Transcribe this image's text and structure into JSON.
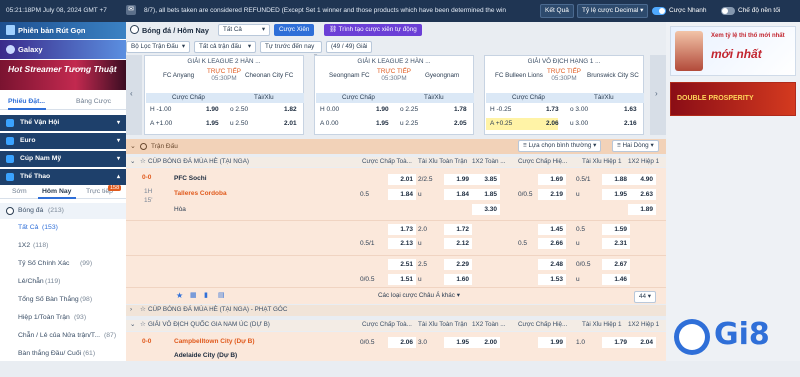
{
  "topbar": {
    "time": "05:21:18PM July 08, 2024 GMT +7",
    "ticker": "8/7), all bets taken are considered REFUNDED (Except Set 1 winner and those products which have been determined the win",
    "result_btn": "Kết Quả",
    "odds_type": "Tỷ lệ cược Decimal",
    "quick_bet": "Cược Nhanh",
    "night_mode": "Chế độ nền tối"
  },
  "sidebar": {
    "banners": [
      "Phiên bản Rút Gọn",
      "Galaxy",
      "Hot Streamer Tương Thuật"
    ],
    "tabs": [
      "Phiếu Đặt...",
      "Bảng Cược"
    ],
    "menu": [
      "Thể Vận Hội",
      "Euro",
      "Cúp Nam Mỹ",
      "Thể Thao"
    ],
    "sport_tabs": [
      "Sớm",
      "Hôm Nay",
      "Trực tiếp"
    ],
    "live_count": "158",
    "sport_header": {
      "name": "Bóng đá",
      "count": "(213)"
    },
    "items": [
      {
        "name": "Tất Cả",
        "count": "(153)"
      },
      {
        "name": "1X2",
        "count": "(118)"
      },
      {
        "name": "Tỷ Số Chính Xác",
        "count": "(99)"
      },
      {
        "name": "Lẻ/Chẵn",
        "count": "(119)"
      },
      {
        "name": "Tổng Số Bàn Thắng",
        "count": "(98)"
      },
      {
        "name": "Hiệp 1/Toàn Trận",
        "count": "(93)"
      },
      {
        "name": "Chẵn / Lẻ của Nửa trận/T...",
        "count": "(87)"
      },
      {
        "name": "Bàn thắng Đầu/ Cuối",
        "count": "(61)"
      }
    ]
  },
  "toolbar": {
    "title": "Bóng đá / Hôm Nay",
    "filter_all": "Tất Cả",
    "parlay_btn": "Cược Xiên",
    "auto_parlay": "Trình tạo cược xiên tự động",
    "league_filter": "Bộ Lọc Trận Đấu",
    "match_filter": "Tất cả trận đấu",
    "sort": "Tự trước đến nay",
    "count": "(49 / 49) Giải"
  },
  "featured": [
    {
      "league": "GIẢI K LEAGUE 2 HÀN ...",
      "home": "FC Anyang",
      "away": "Cheonan City FC",
      "live": "TRỰC TIẾP",
      "time": "05:30PM",
      "rows": [
        [
          "H -1.00",
          "1.90",
          "o 2.50",
          "1.82"
        ],
        [
          "A +1.00",
          "1.95",
          "u 2.50",
          "2.01"
        ]
      ]
    },
    {
      "league": "GIẢI K LEAGUE 2 HÀN ...",
      "home": "Seongnam FC",
      "away": "Gyeongnam",
      "live": "TRỰC TIẾP",
      "time": "05:30PM",
      "rows": [
        [
          "H 0.00",
          "1.90",
          "o 2.25",
          "1.78"
        ],
        [
          "A 0.00",
          "1.95",
          "u 2.25",
          "2.05"
        ]
      ]
    },
    {
      "league": "GIẢI VÔ ĐỊCH HẠNG 1 ...",
      "home": "FC Bulleen Lions",
      "away": "Brunswick City SC",
      "live": "TRỰC TIẾP",
      "time": "05:30PM",
      "rows": [
        [
          "H -0.25",
          "1.73",
          "o 3.00",
          "1.63"
        ],
        [
          "A +0.25",
          "2.06",
          "u 3.00",
          "2.16"
        ]
      ]
    }
  ],
  "card_headers": {
    "handicap": "Cược Chấp",
    "ou": "Tài/Xỉu"
  },
  "section": {
    "title": "Trận Đấu",
    "sort": "Lựa chọn bình thường",
    "view": "Hai Dòng"
  },
  "columns": [
    "Cược Chấp Toà...",
    "Tài Xỉu Toàn Trận",
    "1X2 Toàn ...",
    "Cược Chấp Hiệ...",
    "Tài Xỉu Hiệp 1",
    "1X2 Hiệp 1"
  ],
  "league1": "CÚP BÓNG ĐÁ MÙA HÈ (TẠI NGA)",
  "match1": {
    "score": "0-0",
    "half": "1H",
    "minute": "15'",
    "home": "PFC Sochi",
    "away": "Talleres Cordoba",
    "draw": "Hòa",
    "lines": [
      [
        "",
        "2.01",
        "2/2.5",
        "1.99",
        "3.85",
        "",
        "1.69",
        "0.5/1",
        "1.88",
        "4.90"
      ],
      [
        "0.5",
        "1.84",
        "u",
        "1.84",
        "1.85",
        "0/0.5",
        "2.19",
        "u",
        "1.95",
        "2.63"
      ],
      [
        "",
        "",
        "",
        "",
        "3.30",
        "",
        "",
        "",
        "",
        "1.89"
      ],
      [
        "",
        "1.73",
        "2.0",
        "1.72",
        "",
        "",
        "1.45",
        "0.5",
        "1.59",
        ""
      ],
      [
        "0.5/1",
        "2.13",
        "u",
        "2.12",
        "",
        "0.5",
        "2.66",
        "u",
        "2.31",
        ""
      ],
      [
        "",
        "2.51",
        "2.5",
        "2.29",
        "",
        "",
        "2.48",
        "0/0.5",
        "2.67",
        ""
      ],
      [
        "0/0.5",
        "1.51",
        "u",
        "1.60",
        "",
        "",
        "1.53",
        "u",
        "1.46",
        ""
      ]
    ],
    "more": "Các loại cược Châu Á khác",
    "more_count": "44"
  },
  "league2": "CÚP BÓNG ĐÁ MÙA HÈ (TẠI NGA) - PHẠT GÓC",
  "league3": "GIẢI VÔ ĐỊCH QUỐC GIA NAM ÚC (DỰ B)",
  "match2": {
    "score": "0-0",
    "home": "Campbelltown City (Dự B)",
    "away": "Adelaide City (Dự B)",
    "line": [
      "0/0.5",
      "2.06",
      "3.0",
      "1.95",
      "2.00",
      "",
      "1.99",
      "1.0",
      "1.79",
      "2.04"
    ]
  },
  "ads": {
    "top_title": "Xem tỷ lệ thi thố mới nhất",
    "top_sub": "mới nhất",
    "promo": "DOUBLE PROSPERITY",
    "logo": "Gi8"
  },
  "colors": {
    "navy": "#1f3553",
    "accent": "#2f6fd8",
    "live": "#e05a1d",
    "section": "#f2d2b8"
  }
}
